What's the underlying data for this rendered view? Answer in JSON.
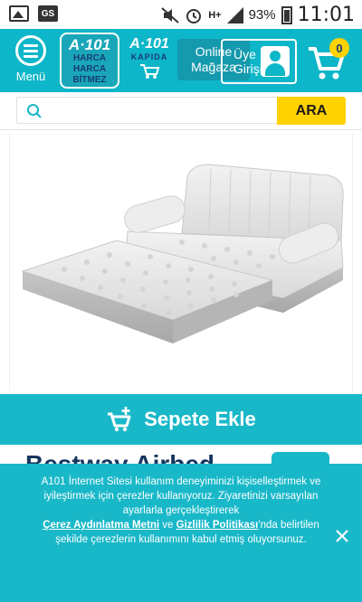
{
  "status_bar": {
    "battery": "93%",
    "time": "11:01",
    "network": "H+",
    "icons": [
      "image-icon",
      "gs-icon",
      "mute-icon",
      "alarm-icon",
      "signal-icon",
      "battery-icon"
    ]
  },
  "header": {
    "menu_label": "Menü",
    "logo": {
      "line1": "A·101",
      "line2": "HARCA",
      "line3": "HARCA",
      "line4": "BİTMEZ"
    },
    "kapida": {
      "line1": "A·101",
      "line2": "KAPIDA"
    },
    "online_store": "Online Mağaza",
    "account": "Üye Girişi",
    "cart_count": "0"
  },
  "search": {
    "placeholder": "",
    "button": "ARA"
  },
  "product": {
    "add_to_cart": "Sepete Ekle",
    "title_partial": "Bestway Airbed"
  },
  "cookie": {
    "text1": "A101 İnternet Sitesi kullanım deneyiminizi kişiselleştirmek ve iyileştirmek için çerezler kullanıyoruz. Ziyaretinizi varsayılan ayarlarla gerçekleştirerek",
    "link1": "Çerez Aydınlatma Metni",
    "and": " ve ",
    "link2": "Gizlilik Politikası",
    "text2": "'nda belirtilen şekilde çerezlerin kullanımını kabul etmiş oluyorsunuz."
  },
  "colors": {
    "brand": "#0db6c8",
    "accent_yellow": "#ffd200",
    "navy": "#163d73"
  }
}
